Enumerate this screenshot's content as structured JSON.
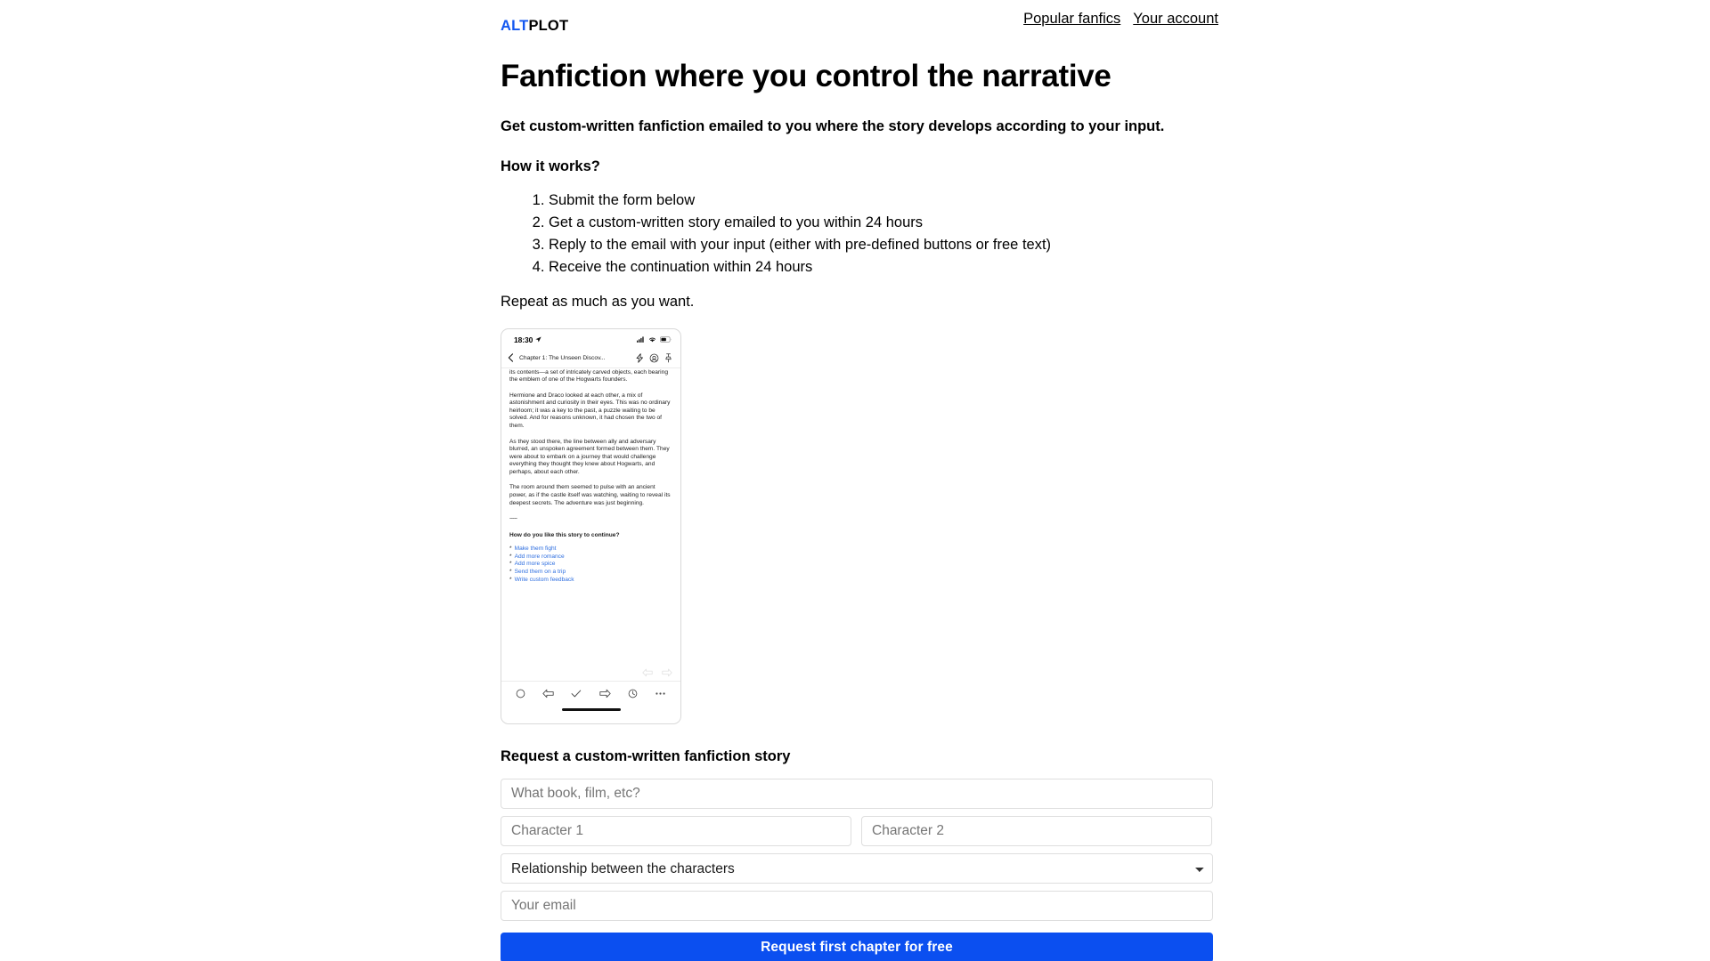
{
  "brand": {
    "alt": "ALT",
    "plot": "PLOT",
    "accent_color": "#1357f0"
  },
  "topnav": {
    "links": [
      {
        "label": "Popular fanfics"
      },
      {
        "label": "Your account"
      }
    ]
  },
  "hero": {
    "headline": "Fanfiction where you control the narrative",
    "subhead": "Get custom-written fanfiction emailed to you where the story develops according to your input.",
    "how_it_works_label": "How it works?",
    "steps": [
      "Submit the form below",
      "Get a custom-written story emailed to you within 24 hours",
      "Reply to the email with your input (either with pre-defined buttons or free text)",
      "Receive the continuation within 24 hours"
    ],
    "repeat_note": "Repeat as much as you want."
  },
  "phone_mockup": {
    "status_bar": {
      "time": "18:30",
      "location_icon": "location-arrow-icon",
      "signal_icon": "cellular-signal-icon",
      "wifi_icon": "wifi-icon",
      "battery_icon": "battery-icon"
    },
    "mail_header": {
      "back_icon": "chevron-left-icon",
      "subject": "Chapter 1: The Unseen Discov...",
      "icons": [
        "lightning-bolt-icon",
        "aperture-circle-icon",
        "pin-icon"
      ]
    },
    "mail_body": {
      "paragraphs": [
        "its contents—a set of intricately carved objects, each bearing the emblem of one of the Hogwarts founders.",
        "Hermione and Draco looked at each other, a mix of astonishment and curiosity in their eyes. This was no ordinary heirloom; it was a key to the past, a puzzle waiting to be solved. And for reasons unknown, it had chosen the two of them.",
        "As they stood there, the line between ally and adversary blurred, an unspoken agreement formed between them. They were about to embark on a journey that would challenge everything they thought they knew about Hogwarts, and perhaps, about each other.",
        "The room around them seemed to pulse with an ancient power, as if the castle itself was watching, waiting to reveal its deepest secrets. The adventure was just beginning."
      ],
      "divider": "-----",
      "question": "How do you like this story to continue?",
      "option_bullet": "*",
      "options": [
        "Make them fight",
        "Add more romance",
        "Add more spice",
        "Send them on a trip",
        "Write custom feedback"
      ],
      "option_color": "#2f6fe0",
      "reply_icons": [
        "reply-arrow-icon",
        "forward-arrow-icon"
      ]
    },
    "toolbar": {
      "icons": [
        "circle-icon",
        "reply-icon",
        "check-icon",
        "forward-icon",
        "clock-icon",
        "more-ellipsis-icon"
      ],
      "home_indicator": "home-indicator-bar"
    }
  },
  "form": {
    "title": "Request a custom-written fanfiction story",
    "fields": {
      "work": {
        "placeholder": "What book, film, etc?",
        "value": ""
      },
      "character1": {
        "placeholder": "Character 1",
        "value": ""
      },
      "character2": {
        "placeholder": "Character 2",
        "value": ""
      },
      "relationship": {
        "selected": "Relationship between the characters",
        "options": [
          "Relationship between the characters"
        ]
      },
      "email": {
        "placeholder": "Your email",
        "value": ""
      }
    },
    "submit_label": "Request first chapter for free",
    "submit_color": "#0b4ff0"
  }
}
